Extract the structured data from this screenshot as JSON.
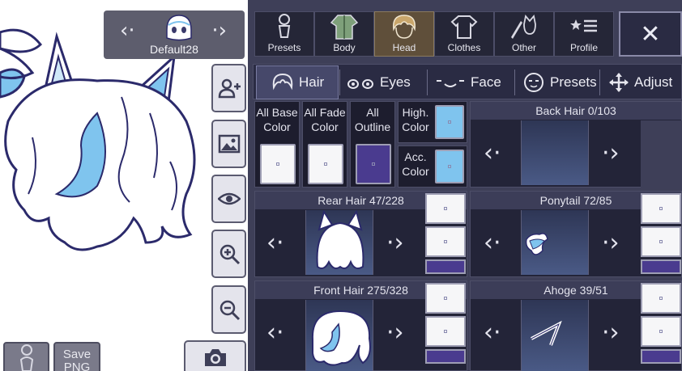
{
  "character": {
    "name": "Default28"
  },
  "categories": [
    {
      "label": "Presets",
      "icon": "person-icon"
    },
    {
      "label": "Body",
      "icon": "shirt-body-icon"
    },
    {
      "label": "Head",
      "icon": "head-hair-icon",
      "active": true
    },
    {
      "label": "Clothes",
      "icon": "tshirt-icon"
    },
    {
      "label": "Other",
      "icon": "sword-cat-icon"
    },
    {
      "label": "Profile",
      "icon": "star-list-icon"
    }
  ],
  "subtabs": [
    {
      "label": "Hair",
      "icon": "hair-icon",
      "active": true
    },
    {
      "label": "Eyes",
      "icon": "eyes-icon"
    },
    {
      "label": "Face",
      "icon": "face-icon"
    },
    {
      "label": "Presets",
      "icon": "face-preset-icon"
    },
    {
      "label": "Adjust",
      "icon": "move-arrows-icon"
    }
  ],
  "color_controls": {
    "all_base": "All Base\nColor",
    "all_fade": "All Fade\nColor",
    "all_outline": "All\nOutline",
    "high": "High.\nColor",
    "acc": "Acc.\nColor",
    "outline_color": "#4a3b8f",
    "highlight_color": "#7fc4ee"
  },
  "pickers": {
    "back_hair": "Back Hair 0/103",
    "rear_hair": "Rear Hair 47/228",
    "ponytail": "Ponytail 72/85",
    "front_hair": "Front Hair 275/328",
    "ahoge": "Ahoge 39/51"
  },
  "bottom": {
    "save_png": "Save\nPNG"
  }
}
